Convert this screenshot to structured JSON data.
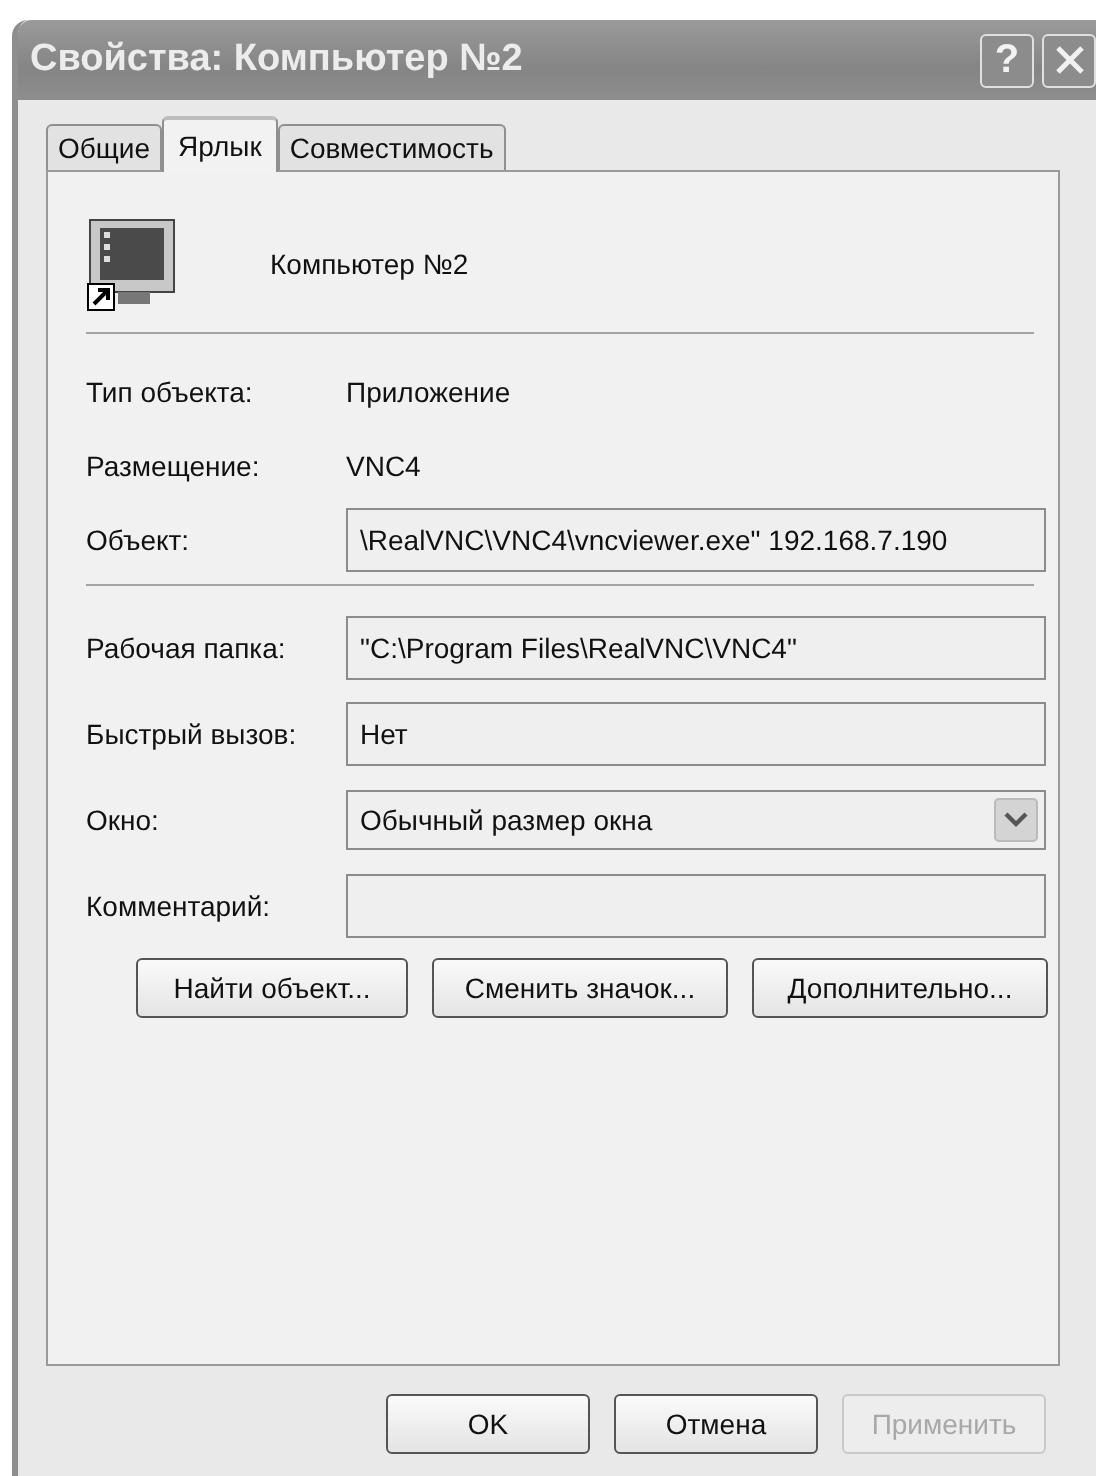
{
  "window": {
    "title": "Свойства: Компьютер №2",
    "help_button": "?"
  },
  "tabs": [
    {
      "label": "Общие",
      "selected": false
    },
    {
      "label": "Ярлык",
      "selected": true
    },
    {
      "label": "Совместимость",
      "selected": false
    }
  ],
  "shortcut": {
    "name": "Компьютер №2"
  },
  "info": [
    {
      "kind": "text",
      "label": "Тип объекта:",
      "value": "Приложение"
    },
    {
      "kind": "text",
      "label": "Размещение:",
      "value": "VNC4"
    },
    {
      "kind": "field",
      "label": "Объект:",
      "value": "\\RealVNC\\VNC4\\vncviewer.exe\" 192.168.7.190"
    }
  ],
  "settings": [
    {
      "kind": "field",
      "label": "Рабочая папка:",
      "value": "\"C:\\Program Files\\RealVNC\\VNC4\""
    },
    {
      "kind": "field",
      "label": "Быстрый вызов:",
      "value": "Нет"
    },
    {
      "kind": "dropdown",
      "label": "Окно:",
      "value": "Обычный размер окна"
    },
    {
      "kind": "field",
      "label": "Комментарий:"
    }
  ],
  "action_buttons": [
    {
      "label": "Найти объект..."
    },
    {
      "label": "Сменить значок..."
    },
    {
      "label": "Дополнительно..."
    }
  ],
  "dialog_buttons": [
    {
      "label": "OK",
      "disabled": false
    },
    {
      "label": "Отмена",
      "disabled": false
    },
    {
      "label": "Применить",
      "disabled": true
    }
  ]
}
